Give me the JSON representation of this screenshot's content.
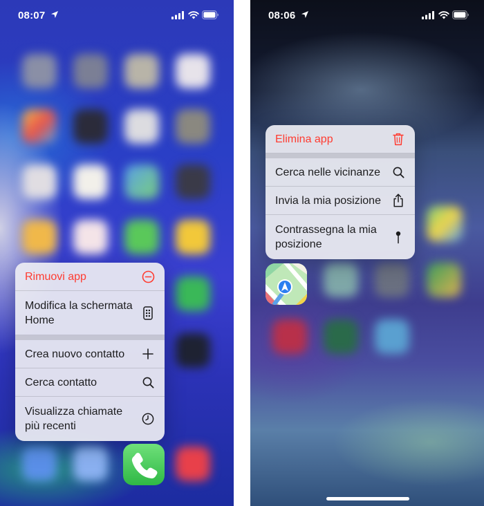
{
  "left_phone": {
    "status": {
      "time": "08:07"
    },
    "menu": {
      "remove_app": "Rimuovi app",
      "edit_home": "Modifica la schermata Home",
      "new_contact": "Crea nuovo contatto",
      "search_contact": "Cerca contatto",
      "recent_calls": "Visualizza chiamate più recenti"
    }
  },
  "right_phone": {
    "status": {
      "time": "08:06"
    },
    "menu": {
      "delete_app": "Elimina app",
      "search_nearby": "Cerca nelle vicinanze",
      "send_location": "Invia la mia posizione",
      "mark_location": "Contrassegna la mia posizione"
    }
  },
  "colors": {
    "destructive": "#ff3b30",
    "menu_background": "#ececf2",
    "phone_app_green": "#34c759"
  },
  "icons": {
    "location_arrow": "location-arrow-icon",
    "signal": "cellular-signal-icon",
    "wifi": "wifi-icon",
    "battery": "battery-icon",
    "remove": "minus-circle-icon",
    "edit_home": "phone-screen-icon",
    "add": "plus-icon",
    "search": "magnifier-icon",
    "recents": "clock-icon",
    "trash": "trash-icon",
    "share": "share-icon",
    "pin": "pin-icon",
    "phone_app": "phone-app-icon",
    "maps_app": "maps-app-icon"
  }
}
